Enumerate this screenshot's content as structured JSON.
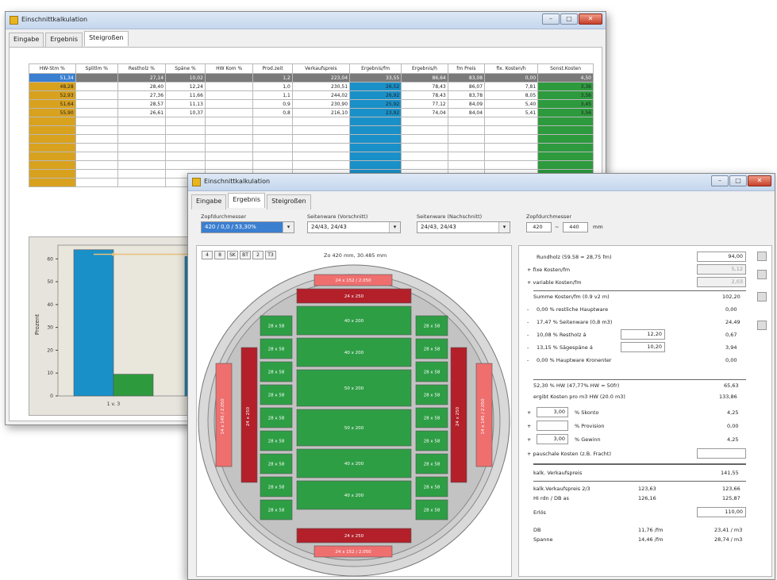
{
  "back_window": {
    "title": "Einschnittkalkulation",
    "tabs": [
      "Eingabe",
      "Ergebnis",
      "Steigroßen"
    ],
    "columns": [
      "HW-Stm %",
      "Splitlm %",
      "Restholz %",
      "Späne %",
      "HW Kom %",
      "Prod.zeit",
      "Verkaufspreis",
      "Ergebnis/fm",
      "Ergebnis/h",
      "fm Preis",
      "fix. Kosten/h",
      "Sonst.Kosten"
    ],
    "rows": [
      [
        "51,34",
        "",
        "27,14",
        "10,02",
        "",
        "1,2",
        "223,04",
        "33,55",
        "86,64",
        "83,08",
        "0,00",
        "4,50"
      ],
      [
        "48,28",
        "",
        "28,40",
        "12,24",
        "",
        "1,0",
        "230,51",
        "26,52",
        "78,43",
        "86,07",
        "7,81",
        "3,36"
      ],
      [
        "52,93",
        "",
        "27,36",
        "11,66",
        "",
        "1,1",
        "244,02",
        "26,92",
        "78,43",
        "83,78",
        "8,05",
        "3,56"
      ],
      [
        "51,64",
        "",
        "28,57",
        "11,13",
        "",
        "0,9",
        "230,90",
        "25,92",
        "77,12",
        "84,09",
        "5,40",
        "3,45"
      ],
      [
        "55,90",
        "",
        "26,61",
        "10,37",
        "",
        "0,8",
        "216,10",
        "23,92",
        "74,04",
        "84,04",
        "5,41",
        "3,56"
      ]
    ],
    "empty_rows": 8,
    "chart_data": {
      "type": "bar",
      "categories": [
        "1 v. 3",
        ""
      ],
      "series": [
        {
          "values": [
            64,
            61
          ]
        },
        {
          "values": [
            9.5,
            null
          ]
        }
      ],
      "ylabel": "Prozent",
      "yticks": [
        0,
        10,
        20,
        30,
        40,
        50,
        60
      ],
      "ylim": [
        0,
        66
      ],
      "line_value": 62,
      "colors": [
        "#1a90c8",
        "#2d9a3e",
        "#e8c07a"
      ]
    }
  },
  "front_window": {
    "title": "Einschnittkalkulation",
    "tabs": [
      "Eingabe",
      "Ergebnis",
      "Steigroßen"
    ],
    "selectors": [
      {
        "label": "Zopfdurchmesser",
        "value": "420 / 0,0 / 53,30%"
      },
      {
        "label": "Seitenware (Vorschnitt)",
        "value": "24/43, 24/43"
      },
      {
        "label": "Seitenware (Nachschnitt)",
        "value": "24/43, 24/43"
      }
    ],
    "diameter": {
      "label": "Zopfdurchmesser",
      "from": "420",
      "to": "440",
      "unit": "mm"
    },
    "toolbar_buttons": [
      "4",
      "8",
      "SK",
      "BT",
      "2",
      "T3"
    ],
    "diagram_header": "Zo 420 mm, 30.485 mm",
    "boards": {
      "top_outer": "24 x 152 / 2.050",
      "top_inner": "24 x 250",
      "bottom_inner": "24 x 250",
      "bottom_outer": "24 x 152 / 2.050",
      "center": [
        "40 x 200",
        "40 x 200",
        "50 x 200",
        "50 x 200",
        "40 x 200",
        "40 x 200"
      ],
      "side_small": "28 x 58",
      "left_outer": "14 x 145 / 2.050",
      "left_inner": "24 x 250",
      "right_inner": "24 x 250",
      "right_outer": "14 x 145 / 2.050"
    },
    "calc": {
      "restholz": "Rundholz  (59.58 = 28,75 fm)",
      "restholz_val": "94,00",
      "fix_kosten": "+ fixe Kosten/fm",
      "fix_val": "5,12",
      "var_kosten": "+ variable Kosten/fm",
      "var_val": "2,03",
      "summe": "Summe Kosten/fm  (0.9 v2 m)",
      "summe_val": "102,20",
      "lines": [
        {
          "op": "-",
          "pct": "0,00 % restliche Hauptware",
          "val": "0,00"
        },
        {
          "op": "-",
          "pct": "17,47 % Seitenware (0,8 m3)",
          "val": "24,49"
        },
        {
          "op": "-",
          "pct": "10,08 % Restholz  á",
          "box": "12,20",
          "val": "0,67"
        },
        {
          "op": "-",
          "pct": "13,15 % Sägespäne á",
          "box": "10,20",
          "val": "3,94"
        },
        {
          "op": "-",
          "pct": "0,00 % Hauptware Kronenter",
          "val": "0,00"
        }
      ],
      "hauptware": "52,30 % HW  (47,77% HW = 50fr)",
      "hauptware_val": "65,63",
      "ergkosten": "ergibt Kosten pro m3 HW  (20.0 m3)",
      "ergkosten_val": "133,86",
      "pct_lines": [
        {
          "op": "+",
          "box": "3,00",
          "label": "% Skonto",
          "val": "4,25"
        },
        {
          "op": "+",
          "box": "",
          "label": "% Provision",
          "val": "0,00"
        },
        {
          "op": "+",
          "box": "3,00",
          "label": "% Gewinn",
          "val": "4,25"
        }
      ],
      "pauschal": "+ pauschale Kosten (z.B. Fracht)",
      "kalk_vk": "kalk. Verkaufspreis",
      "kalk_vk_val": "141,55",
      "kalk_vk2": "kalk.Verkaufspreis 2/3",
      "kalk_vk2_a": "123,63",
      "kalk_vk2_b": "123,66",
      "hw_cs": "HI rdn / DB as",
      "hw_cs_a": "126,16",
      "hw_cs_b": "125,87",
      "erloes": "Erlös",
      "erloes_val": "110,00",
      "db": "DB",
      "db_a": "11,76 /fm",
      "db_b": "23,41 / m3",
      "spanne": "Spanne",
      "spanne_a": "14,46 /fm",
      "spanne_b": "28,74 / m3"
    }
  }
}
